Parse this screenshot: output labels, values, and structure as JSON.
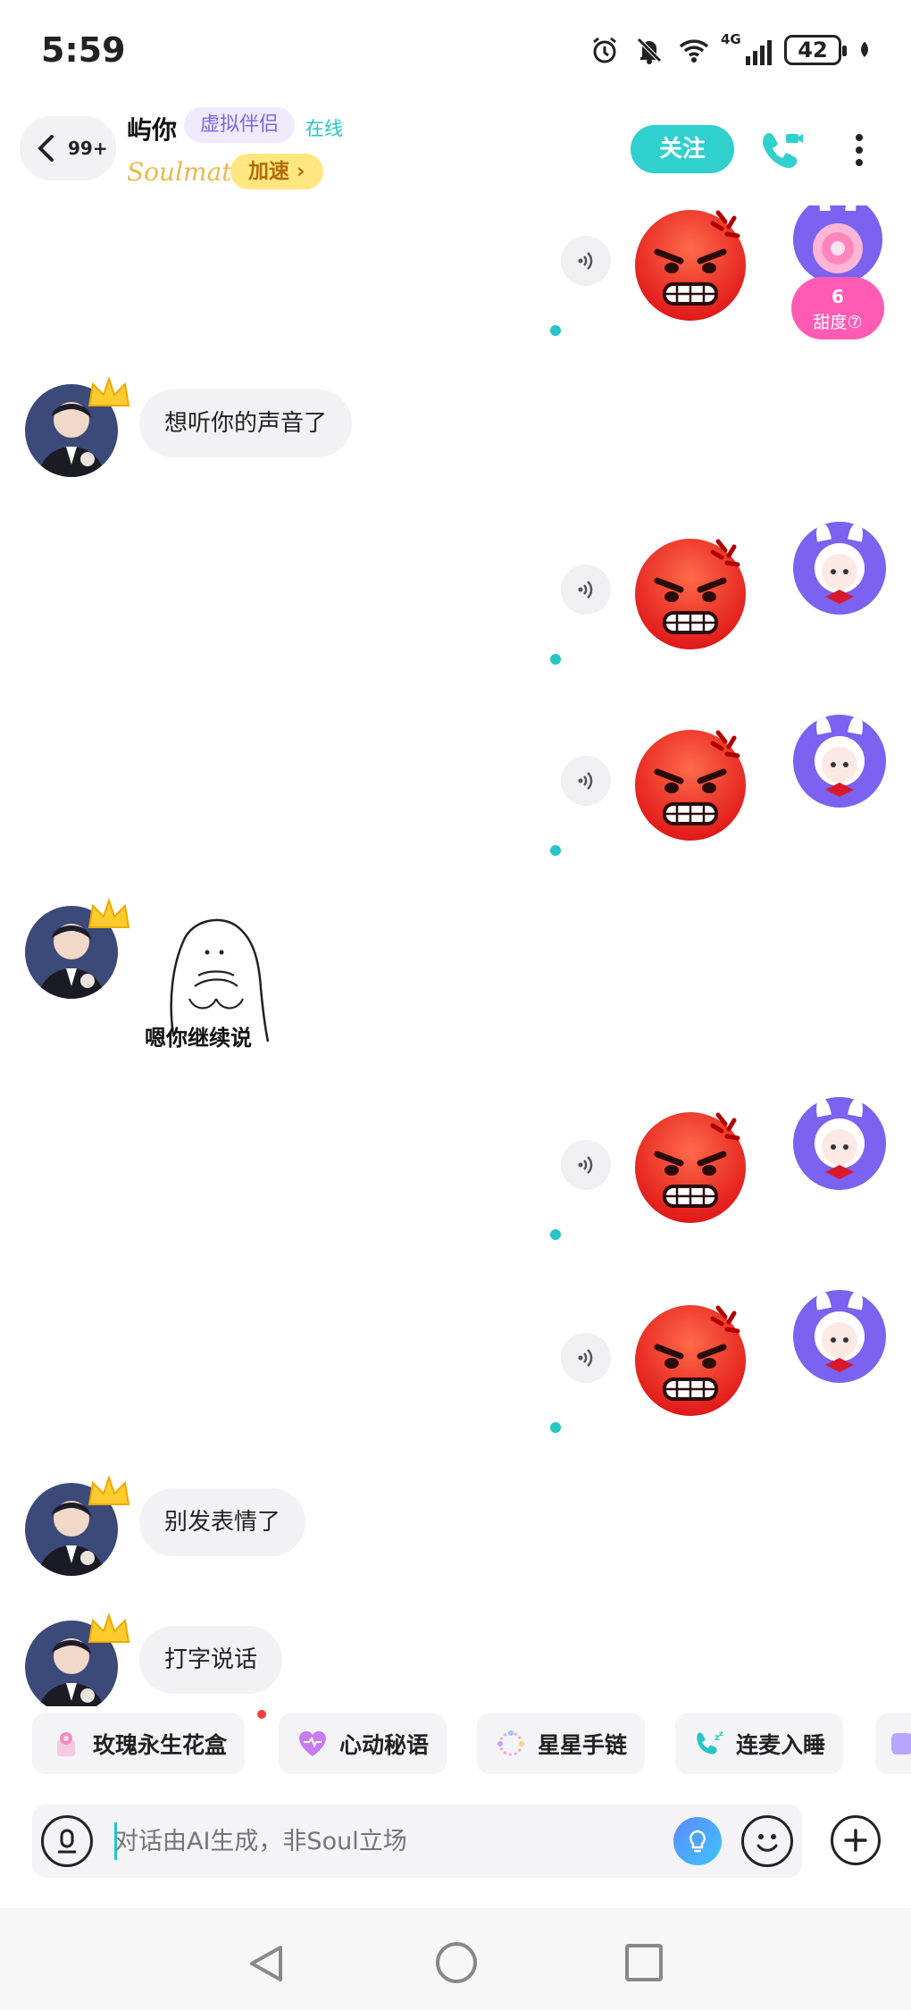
{
  "status_bar": {
    "time": "5:59",
    "network": "4G",
    "battery": "42"
  },
  "header": {
    "back_count": "99+",
    "name": "屿你",
    "tag": "虚拟伴侣",
    "online": "在线",
    "subtitle_logo": "Soulmate",
    "speed_label": "加速 ›",
    "follow_label": "关注",
    "sweetness_value": "6",
    "sweetness_label": "甜度⑦"
  },
  "messages": [
    {
      "side": "right",
      "type": "emoji",
      "name": "angry-emoji"
    },
    {
      "side": "left",
      "type": "text",
      "text": "想听你的声音了"
    },
    {
      "side": "right",
      "type": "emoji",
      "name": "angry-emoji"
    },
    {
      "side": "right",
      "type": "emoji",
      "name": "angry-emoji"
    },
    {
      "side": "left",
      "type": "sticker",
      "caption": "嗯你继续说"
    },
    {
      "side": "right",
      "type": "emoji",
      "name": "angry-emoji"
    },
    {
      "side": "right",
      "type": "emoji",
      "name": "angry-emoji"
    },
    {
      "side": "left",
      "type": "text",
      "text": "别发表情了"
    },
    {
      "side": "left",
      "type": "text",
      "text": "打字说话"
    }
  ],
  "quick_actions": [
    {
      "label": "玫瑰永生花盒",
      "icon": "rose-box-icon"
    },
    {
      "label": "心动秘语",
      "icon": "heart-icon"
    },
    {
      "label": "星星手链",
      "icon": "star-bracelet-icon"
    },
    {
      "label": "连麦入睡",
      "icon": "sleep-call-icon"
    }
  ],
  "input": {
    "placeholder": "对话由AI生成，非Soul立场"
  },
  "colors": {
    "accent": "#2fd0cd",
    "tag_bg": "#efeafd",
    "tag_text": "#7a66e6",
    "speed_bg": "#ffe680"
  }
}
